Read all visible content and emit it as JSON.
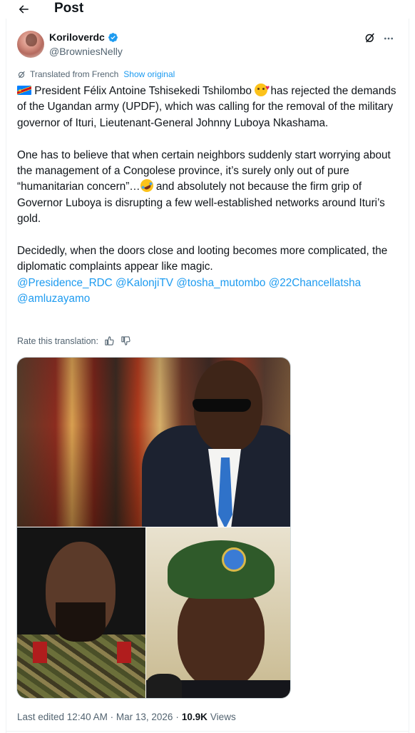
{
  "header": {
    "title": "Post"
  },
  "author": {
    "display_name": "Koriloverdc",
    "handle": "@BrowniesNelly",
    "verified": true
  },
  "translation": {
    "label": "Translated from French",
    "show_original": "Show original",
    "rate_label": "Rate this translation:"
  },
  "tweet": {
    "p1_a": "President Félix Antoine Tshisekedi Tshilombo",
    "p1_b": "has rejected the demands of the Ugandan army (UPDF), which was calling for the removal of the military governor of Ituri, Lieutenant-General Johnny Luboya Nkashama.",
    "p2_a": "One has to believe that when certain neighbors suddenly start worrying about the management of a Congolese province, it’s surely only out of pure “humanitarian concern”…",
    "p2_b": "and absolutely not because the firm grip of Governor Luboya is disrupting a few well-established networks around Ituri’s gold.",
    "p3": "Decidedly, when the doors close and looting becomes more complicated, the diplomatic complaints appear like magic.",
    "mentions": [
      "@Presidence_RDC",
      "@KalonjiTV",
      "@tosha_mutombo",
      "@22Chancellatsha",
      "@amluzayamo"
    ]
  },
  "footer": {
    "edited": "Last edited 12:40 AM · Mar 13, 2026",
    "views_count": "10.9K",
    "views_label": "Views"
  },
  "colors": {
    "text": "#0f1419",
    "secondary": "#536471",
    "link": "#1d9bf0",
    "verified": "#1d9bf0",
    "divider": "#eff3f4"
  },
  "icons": {
    "back": "arrow-left-icon",
    "verified": "verified-badge-icon",
    "grok": "grok-icon",
    "more": "more-horizontal-icon",
    "translate": "translate-icon",
    "thumbs_up": "thumbs-up-icon",
    "thumbs_down": "thumbs-down-icon"
  }
}
